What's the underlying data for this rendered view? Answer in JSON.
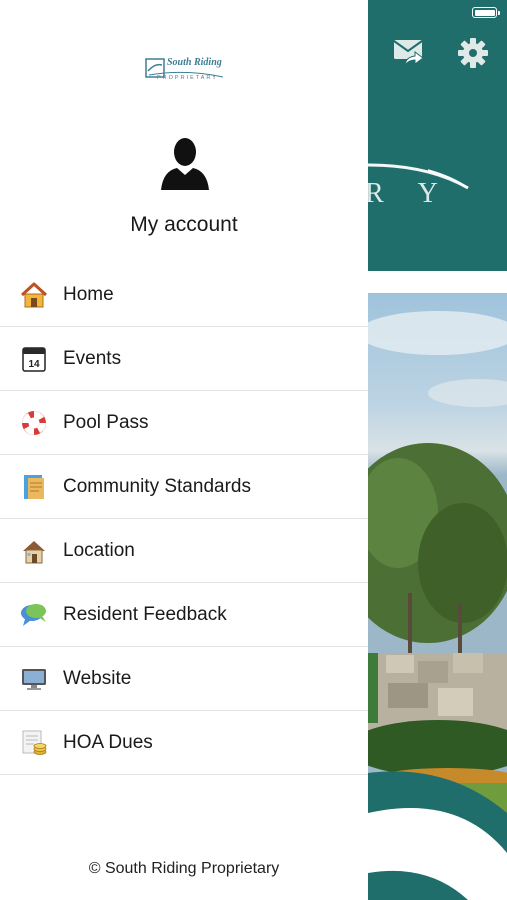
{
  "drawer": {
    "logo": {
      "name": "South Riding",
      "subtitle": "PROPRIETARY"
    },
    "account_label": "My account",
    "menu": [
      {
        "label": "Home",
        "icon": "house-icon"
      },
      {
        "label": "Events",
        "icon": "calendar-icon"
      },
      {
        "label": "Pool Pass",
        "icon": "lifebuoy-icon"
      },
      {
        "label": "Community Standards",
        "icon": "document-icon"
      },
      {
        "label": "Location",
        "icon": "location-house-icon"
      },
      {
        "label": "Resident Feedback",
        "icon": "chat-bubbles-icon"
      },
      {
        "label": "Website",
        "icon": "monitor-icon"
      },
      {
        "label": "HOA Dues",
        "icon": "bill-coins-icon"
      }
    ],
    "events_icon_day": "14",
    "footer": "© South Riding Proprietary"
  },
  "background": {
    "header_color": "#1f6e6b",
    "header_letters": "R Y",
    "icons": [
      "mail-forward-icon",
      "gear-icon",
      "battery-icon"
    ]
  }
}
